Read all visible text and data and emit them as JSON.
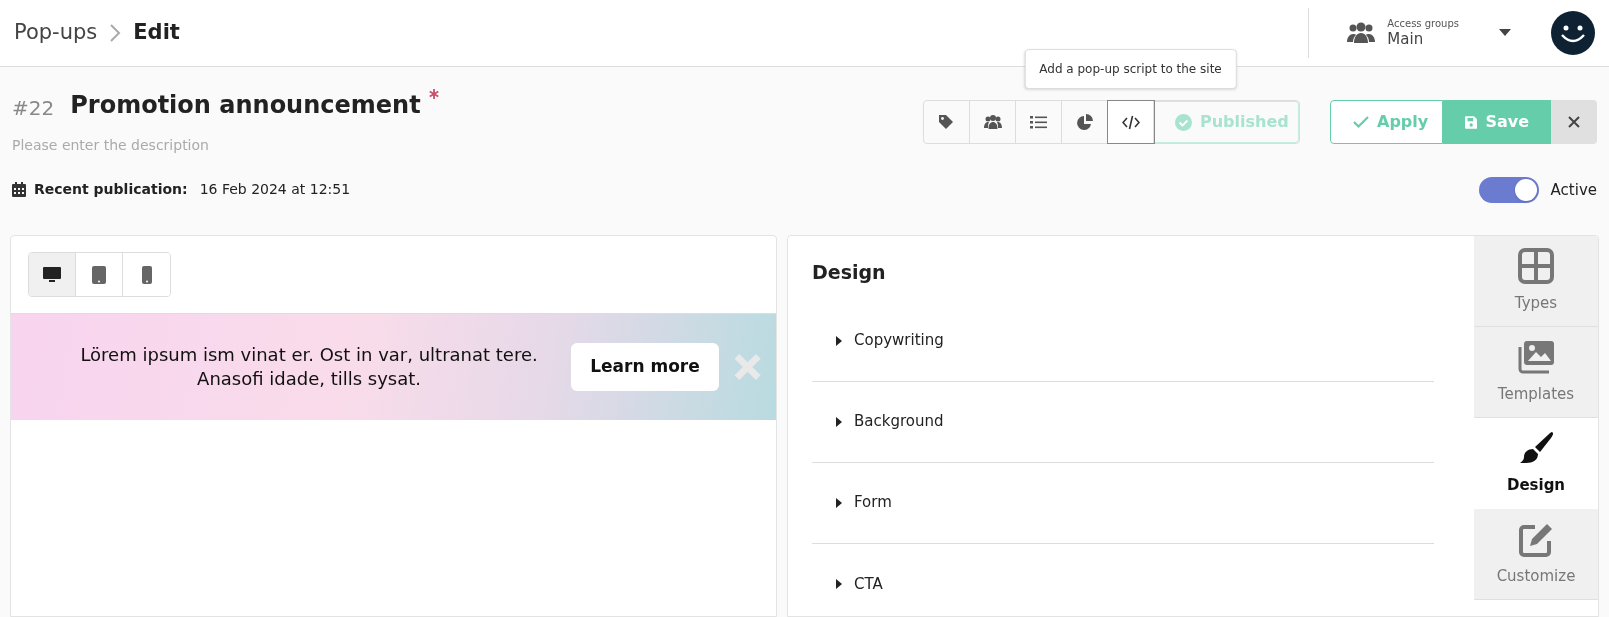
{
  "breadcrumb": [
    "Pop-ups",
    "Edit"
  ],
  "access_groups": {
    "label": "Access groups",
    "value": "Main"
  },
  "title": {
    "number": "#22",
    "name": "Promotion announcement",
    "required": true
  },
  "description": {
    "placeholder": "Please enter the description"
  },
  "publication": {
    "label": "Recent publication:",
    "value": "16 Feb 2024 at 12:51"
  },
  "toolbar": [
    {
      "kind": "tags",
      "selected": false
    },
    {
      "kind": "users",
      "selected": false
    },
    {
      "kind": "list",
      "selected": false
    },
    {
      "kind": "pie",
      "selected": false
    },
    {
      "kind": "code",
      "selected": true,
      "tooltip": "Add a pop-up script to the site"
    }
  ],
  "status": {
    "label": "Published",
    "disabled": true
  },
  "actions": {
    "apply": "Apply",
    "save": "Save"
  },
  "active_toggle": {
    "label": "Active",
    "on": true
  },
  "devices": [
    {
      "kind": "desktop",
      "selected": true
    },
    {
      "kind": "tablet",
      "selected": false
    },
    {
      "kind": "phone",
      "selected": false
    }
  ],
  "banner": {
    "text": "Lörem ipsum ism vinat er. Ost in var, ultranat tere. Anasofi idade, tills sysat.",
    "button": "Learn more"
  },
  "design": {
    "title": "Design",
    "sections": [
      {
        "label": "Copywriting",
        "expanded": false
      },
      {
        "label": "Background",
        "expanded": false
      },
      {
        "label": "Form",
        "expanded": false
      },
      {
        "label": "CTA",
        "expanded": false
      }
    ]
  },
  "side_tabs": [
    {
      "kind": "types",
      "label": "Types",
      "selected": false
    },
    {
      "kind": "templates",
      "label": "Templates",
      "selected": false
    },
    {
      "kind": "design",
      "label": "Design",
      "selected": true
    },
    {
      "kind": "customize",
      "label": "Customize",
      "selected": false
    }
  ]
}
